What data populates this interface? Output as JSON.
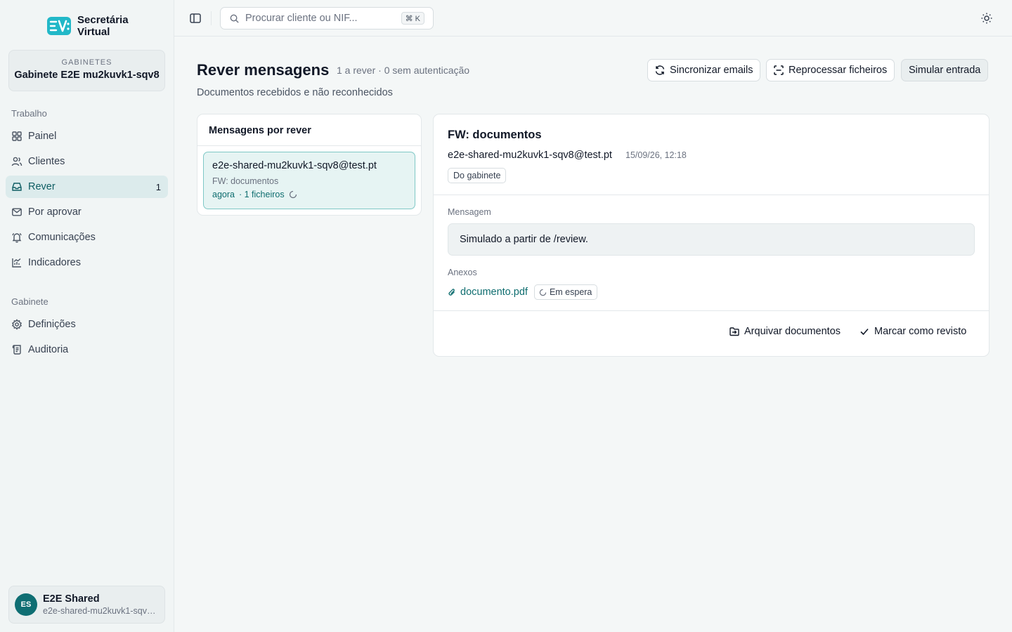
{
  "brand": {
    "name": "Secretária Virtual",
    "logo_text": "SV"
  },
  "office": {
    "label": "GABINETES",
    "name": "Gabinete E2E mu2kuvk1-sqv8"
  },
  "sidebar": {
    "sections": [
      {
        "title": "Trabalho",
        "items": [
          {
            "label": "Painel",
            "icon": "grid-icon"
          },
          {
            "label": "Clientes",
            "icon": "users-icon"
          },
          {
            "label": "Rever",
            "icon": "inbox-icon",
            "badge": "1",
            "active": true
          },
          {
            "label": "Por aprovar",
            "icon": "mail-icon"
          },
          {
            "label": "Comunicações",
            "icon": "bell-icon"
          },
          {
            "label": "Indicadores",
            "icon": "chart-icon"
          }
        ]
      },
      {
        "title": "Gabinete",
        "items": [
          {
            "label": "Definições",
            "icon": "gear-icon"
          },
          {
            "label": "Auditoria",
            "icon": "scroll-icon"
          }
        ]
      }
    ]
  },
  "user": {
    "initials": "ES",
    "name": "E2E Shared",
    "email": "e2e-shared-mu2kuvk1-sqv8@test.pt"
  },
  "search": {
    "placeholder": "Procurar cliente ou NIF...",
    "shortcut": "⌘ K"
  },
  "header": {
    "title": "Rever mensagens",
    "meta": "1 a rever · 0 sem autenticação",
    "subtitle": "Documentos recebidos e não reconhecidos",
    "buttons": {
      "sync": "Sincronizar emails",
      "reprocess": "Reprocessar ficheiros",
      "simulate": "Simular entrada"
    }
  },
  "list": {
    "title": "Mensagens por rever",
    "items": [
      {
        "from": "e2e-shared-mu2kuvk1-sqv8@test.pt",
        "subject": "FW: documentos",
        "time": "agora",
        "files": "· 1 ficheiros"
      }
    ]
  },
  "detail": {
    "subject": "FW: documentos",
    "from": "e2e-shared-mu2kuvk1-sqv8@test.pt",
    "date": "15/09/26, 12:18",
    "tag": "Do gabinete",
    "message_label": "Mensagem",
    "message_body": "Simulado a partir de /review.",
    "attachments_label": "Anexos",
    "attachment": {
      "name": "documento.pdf",
      "status": "Em espera"
    },
    "actions": {
      "archive": "Arquivar documentos",
      "mark_reviewed": "Marcar como revisto"
    }
  },
  "colors": {
    "accent": "#0f6e73",
    "active_bg": "#dcebec",
    "selected_item_bg": "#e6f4f3"
  }
}
